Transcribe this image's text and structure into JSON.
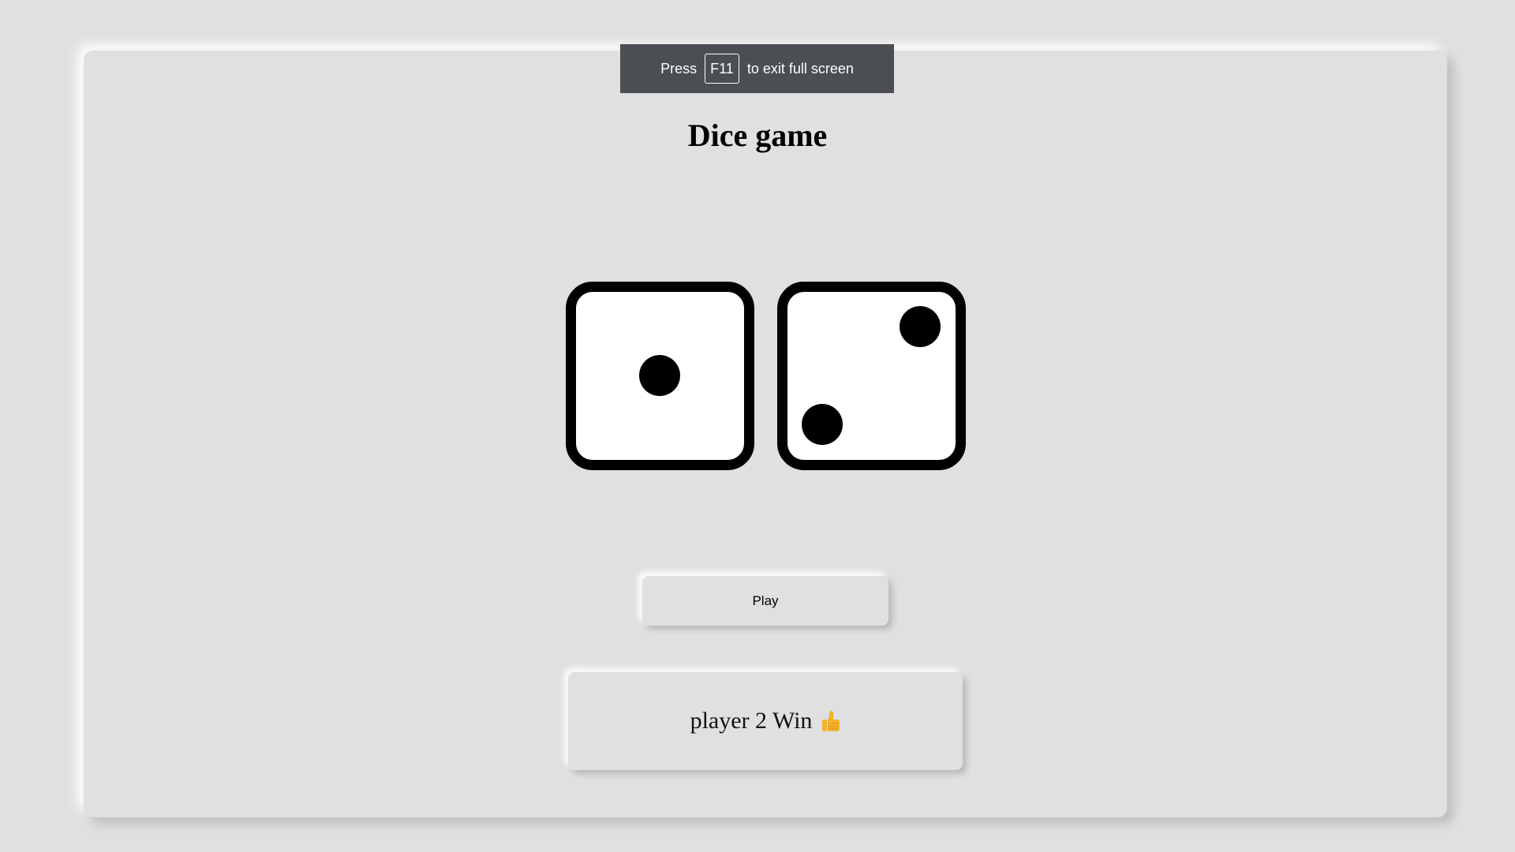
{
  "fullscreen_notice": {
    "press": "Press",
    "key": "F11",
    "message": "to exit full screen"
  },
  "game": {
    "title": "Dice game",
    "dice": [
      1,
      2
    ],
    "play_label": "Play",
    "result_text": "player 2 Win",
    "result_icon": "thumbs-up-icon"
  },
  "colors": {
    "background": "#e0e0e0",
    "banner": "#4b4e52",
    "die_face": "#ffffff",
    "pip": "#000000",
    "thumb": "#f3b22d"
  }
}
